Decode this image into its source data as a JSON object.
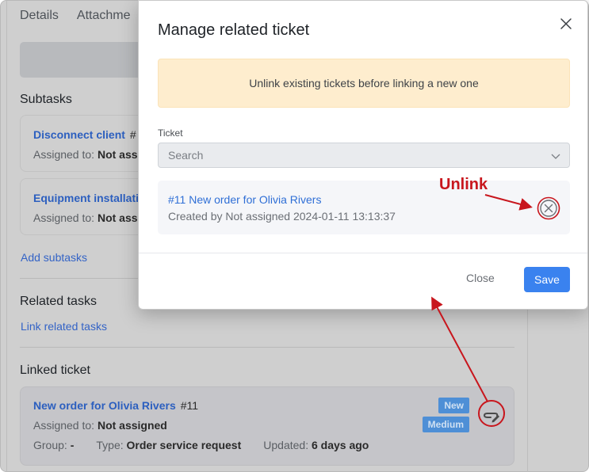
{
  "background": {
    "tabs": [
      {
        "label": "Details"
      },
      {
        "label": "Attachme"
      }
    ],
    "subtasks": {
      "title": "Subtasks",
      "items": [
        {
          "title": "Disconnect client",
          "number": "#",
          "assigned_label": "Assigned to:",
          "assigned_value": "Not assi"
        },
        {
          "title": "Equipment installati",
          "number": "",
          "assigned_label": "Assigned to:",
          "assigned_value": "Not ass"
        }
      ],
      "add_link": "Add subtasks"
    },
    "related_tasks": {
      "title": "Related tasks",
      "link": "Link related tasks"
    },
    "linked_ticket": {
      "title": "Linked ticket",
      "ticket_title": "New order for Olivia Rivers",
      "ticket_number": "#11",
      "assigned_label": "Assigned to:",
      "assigned_value": "Not assigned",
      "group_label": "Group:",
      "group_value": "-",
      "type_label": "Type:",
      "type_value": "Order service request",
      "updated_label": "Updated:",
      "updated_value": "6 days ago",
      "status_badge": "New",
      "priority_badge": "Medium",
      "edit_icon": "link-edit-icon"
    }
  },
  "modal": {
    "title": "Manage related ticket",
    "close_icon": "close-icon",
    "alert": "Unlink existing tickets before linking a new one",
    "ticket_field": {
      "label": "Ticket",
      "placeholder": "Search"
    },
    "linked_item": {
      "title": "#11 New order for Olivia Rivers",
      "created": "Created by Not assigned 2024-01-11 13:13:37",
      "unlink_icon": "circle-x-icon"
    },
    "footer": {
      "close_label": "Close",
      "save_label": "Save"
    }
  },
  "annotations": {
    "unlink_label": "Unlink",
    "color": "#c8161d"
  },
  "colors": {
    "accent": "#3a82ef",
    "link": "#2f6fd6",
    "alert_bg": "#feedce",
    "badge": "#4e8fd6"
  }
}
